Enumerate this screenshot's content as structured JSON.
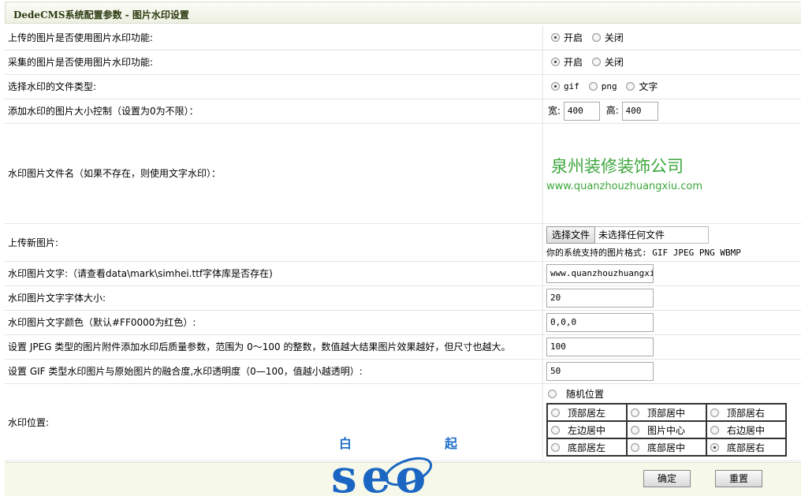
{
  "header": {
    "title": "DedeCMS系统配置参数 - 图片水印设置"
  },
  "rows": {
    "upload_wm": {
      "label": "上传的图片是否使用图片水印功能:",
      "on": "开启",
      "off": "关闭"
    },
    "collect_wm": {
      "label": "采集的图片是否使用图片水印功能:",
      "on": "开启",
      "off": "关闭"
    },
    "file_type": {
      "label": "选择水印的文件类型:",
      "gif": "gif",
      "png": "png",
      "text": "文字"
    },
    "size": {
      "label": "添加水印的图片大小控制（设置为0为不限）：",
      "w_label": "宽:",
      "w_value": "400",
      "h_label": "高:",
      "h_value": "400"
    },
    "wm_file": {
      "label": "水印图片文件名（如果不存在，则使用文字水印）：",
      "preview_title": "泉州装修装饰公司",
      "preview_url": "www.quanzhouzhuangxiu.com"
    },
    "upload_new": {
      "label": "上传新图片:",
      "button": "选择文件",
      "filename": "未选择任何文件",
      "formats": "你的系统支持的图片格式: GIF JPEG PNG WBMP"
    },
    "wm_text": {
      "label": "水印图片文字:（请查看data\\mark\\simhei.ttf字体库是否存在)",
      "value": "www.quanzhouzhuangxiu"
    },
    "font_size": {
      "label": "水印图片文字字体大小:",
      "value": "20"
    },
    "font_color": {
      "label": "水印图片文字颜色（默认#FF0000为红色）:",
      "value": "0,0,0"
    },
    "jpeg_quality": {
      "label": "设置 JPEG 类型的图片附件添加水印后质量参数，范围为 0～100 的整数，数值越大结果图片效果越好，但尺寸也越大。",
      "value": "100"
    },
    "gif_alpha": {
      "label": "设置 GIF 类型水印图片与原始图片的融合度,水印透明度（0—100，值越小越透明）:",
      "value": "50"
    },
    "position": {
      "label": "水印位置:",
      "random": "随机位置",
      "grid": [
        [
          "顶部居左",
          "顶部居中",
          "顶部居右"
        ],
        [
          "左边居中",
          "图片中心",
          "右边居中"
        ],
        [
          "底部居左",
          "底部居中",
          "底部居右"
        ]
      ]
    }
  },
  "footer": {
    "ok": "确定",
    "reset": "重置"
  },
  "logo": {
    "bai": "白",
    "qi": "起",
    "letters": "seo"
  }
}
